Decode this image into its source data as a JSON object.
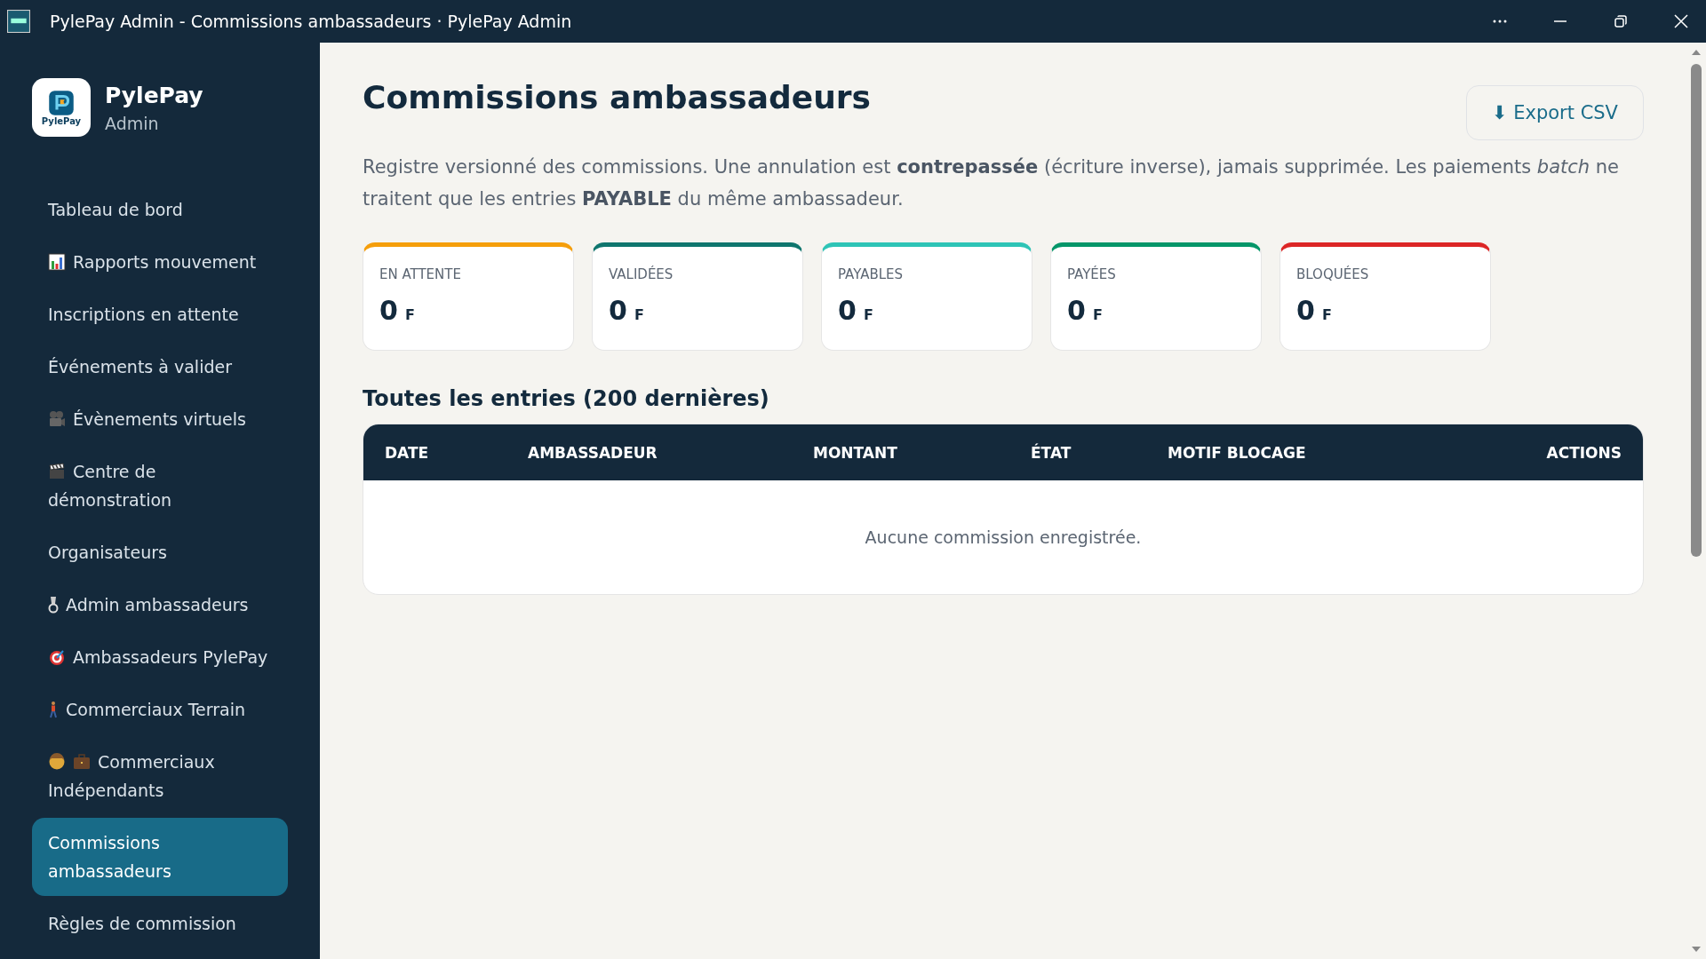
{
  "window": {
    "title": "PylePay Admin - Commissions ambassadeurs · PylePay Admin"
  },
  "brand": {
    "name": "PylePay",
    "subtitle": "Admin",
    "logo_text": "PylePay"
  },
  "sidebar": {
    "items": [
      {
        "label": "Tableau de bord",
        "selected": false,
        "kind": "plain"
      },
      {
        "label": "Rapports mouvement",
        "selected": false,
        "kind": "chart"
      },
      {
        "label": "Inscriptions en attente",
        "selected": false,
        "kind": "plain"
      },
      {
        "label": "Événements à valider",
        "selected": false,
        "kind": "plain"
      },
      {
        "label": "Évènements virtuels",
        "selected": false,
        "kind": "camera"
      },
      {
        "label": "Centre de démonstration",
        "selected": false,
        "kind": "clapper"
      },
      {
        "label": "Organisateurs",
        "selected": false,
        "kind": "plain"
      },
      {
        "label": "Admin ambassadeurs",
        "selected": false,
        "kind": "medal"
      },
      {
        "label": "Ambassadeurs PylePay",
        "selected": false,
        "kind": "target"
      },
      {
        "label": "Commerciaux Terrain",
        "selected": false,
        "kind": "walker"
      },
      {
        "label": "Commerciaux Indépendants",
        "selected": false,
        "kind": "business"
      },
      {
        "label": "Commissions ambassadeurs",
        "selected": true,
        "kind": "plain"
      },
      {
        "label": "Règles de commission",
        "selected": false,
        "kind": "plain"
      }
    ]
  },
  "page": {
    "title": "Commissions ambassadeurs",
    "export_button": "⬇ Export CSV",
    "description": "Registre versionné des commissions. Une annulation est **contrepassée** (écriture inverse), jamais supprimée. Les paiements *batch* ne traitent que les entries **PAYABLE** du même ambassadeur."
  },
  "stats": [
    {
      "label": "EN ATTENTE",
      "value": "0",
      "unit": "F",
      "color": "#f59e0b"
    },
    {
      "label": "VALIDÉES",
      "value": "0",
      "unit": "F",
      "color": "#0f766e"
    },
    {
      "label": "PAYABLES",
      "value": "0",
      "unit": "F",
      "color": "#2ec4b6"
    },
    {
      "label": "PAYÉES",
      "value": "0",
      "unit": "F",
      "color": "#059669"
    },
    {
      "label": "BLOQUÉES",
      "value": "0",
      "unit": "F",
      "color": "#dc2626"
    }
  ],
  "table": {
    "title": "Toutes les entries (200 dernières)",
    "columns": [
      "DATE",
      "AMBASSADEUR",
      "MONTANT",
      "ÉTAT",
      "MOTIF BLOCAGE",
      "ACTIONS"
    ],
    "empty_message": "Aucune commission enregistrée."
  }
}
